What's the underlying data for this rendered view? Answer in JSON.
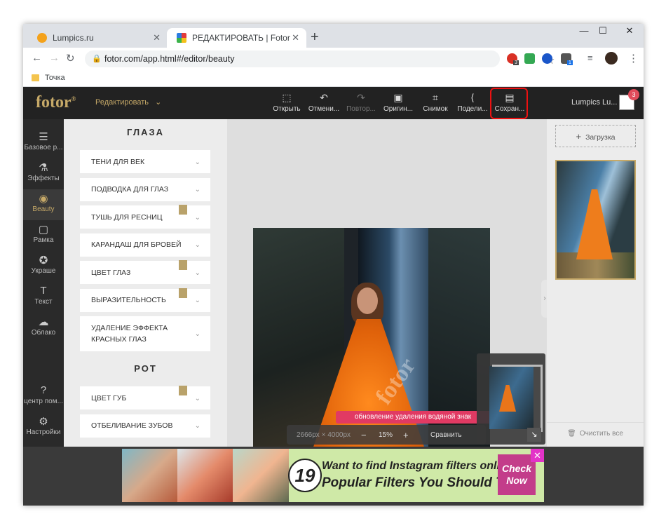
{
  "browser": {
    "tabs": [
      {
        "title": "Lumpics.ru",
        "favicon_color": "#f4a21b"
      },
      {
        "title": "РЕДАКТИРОВАТЬ | Fotor",
        "favicon_color": "#e23b3b"
      }
    ],
    "url": "fotor.com/app.html#/editor/beauty",
    "bookmark": "Точка",
    "window_controls": [
      "—",
      "☐",
      "✕"
    ],
    "ext_badges": [
      "3",
      "1"
    ]
  },
  "app": {
    "logo": "fotor",
    "edit_menu": "Редактировать",
    "toolbar": [
      {
        "label": "Открыть",
        "icon": "open-icon",
        "glyph": "⬚",
        "disabled": false
      },
      {
        "label": "Отмени...",
        "icon": "undo-icon",
        "glyph": "↶",
        "disabled": false
      },
      {
        "label": "Повтор...",
        "icon": "redo-icon",
        "glyph": "↷",
        "disabled": true
      },
      {
        "label": "Оригин...",
        "icon": "original-icon",
        "glyph": "▣",
        "disabled": false
      },
      {
        "label": "Снимок",
        "icon": "snapshot-icon",
        "glyph": "⌗",
        "disabled": false
      },
      {
        "label": "Подели...",
        "icon": "share-icon",
        "glyph": "⟨",
        "disabled": false
      },
      {
        "label": "Сохран...",
        "icon": "save-icon",
        "glyph": "▤",
        "disabled": false
      }
    ],
    "user": "Lumpics Lu...",
    "notification_count": "3",
    "highlight_color": "#e11111",
    "accent": "#c6a968"
  },
  "leftbar": [
    {
      "label": "Базовое р...",
      "icon": "sliders-icon",
      "glyph": "☰",
      "active": false
    },
    {
      "label": "Эффекты",
      "icon": "flask-icon",
      "glyph": "⚗",
      "active": false
    },
    {
      "label": "Beauty",
      "icon": "eye-icon",
      "glyph": "◉",
      "active": true
    },
    {
      "label": "Рамка",
      "icon": "frame-icon",
      "glyph": "▢",
      "active": false
    },
    {
      "label": "Украше",
      "icon": "star-icon",
      "glyph": "✪",
      "active": false
    },
    {
      "label": "Текст",
      "icon": "text-icon",
      "glyph": "T",
      "active": false
    },
    {
      "label": "Облако",
      "icon": "cloud-icon",
      "glyph": "☁",
      "active": false
    },
    {
      "label": "центр пом...",
      "icon": "help-icon",
      "glyph": "?",
      "active": false
    },
    {
      "label": "Настройки",
      "icon": "settings-icon",
      "glyph": "⚙",
      "active": false
    }
  ],
  "panel": {
    "eyes_title": "ГЛАЗА",
    "eyes_items": [
      {
        "label": "ТЕНИ ДЛЯ ВЕК",
        "premium": false
      },
      {
        "label": "ПОДВОДКА ДЛЯ ГЛАЗ",
        "premium": false
      },
      {
        "label": "ТУШЬ ДЛЯ РЕСНИЦ",
        "premium": true
      },
      {
        "label": "КАРАНДАШ ДЛЯ БРОВЕЙ",
        "premium": false
      },
      {
        "label": "ЦВЕТ ГЛАЗ",
        "premium": true
      },
      {
        "label": "ВЫРАЗИТЕЛЬНОСТЬ",
        "premium": true
      },
      {
        "label": "УДАЛЕНИЕ ЭФФЕКТА КРАСНЫХ ГЛАЗ",
        "premium": false
      }
    ],
    "mouth_title": "РОТ",
    "mouth_items": [
      {
        "label": "ЦВЕТ ГУБ",
        "premium": true
      },
      {
        "label": "ОТБЕЛИВАНИЕ ЗУБОВ",
        "premium": false
      }
    ]
  },
  "canvas": {
    "watermark_text": "обновление удаления водяной знак",
    "watermark_logo": "fotor",
    "dimensions": "2666px × 4000px",
    "zoom": "15%",
    "zoom_minus": "−",
    "zoom_plus": "+",
    "compare": "Сравнить"
  },
  "right": {
    "upload": "Загрузка",
    "clear": "Очистить все"
  },
  "ad": {
    "number": "19",
    "line1": "Want to find Instagram filters online?",
    "line2": "Popular Filters You Should Try",
    "cta": "Check Now",
    "close": "✕"
  }
}
